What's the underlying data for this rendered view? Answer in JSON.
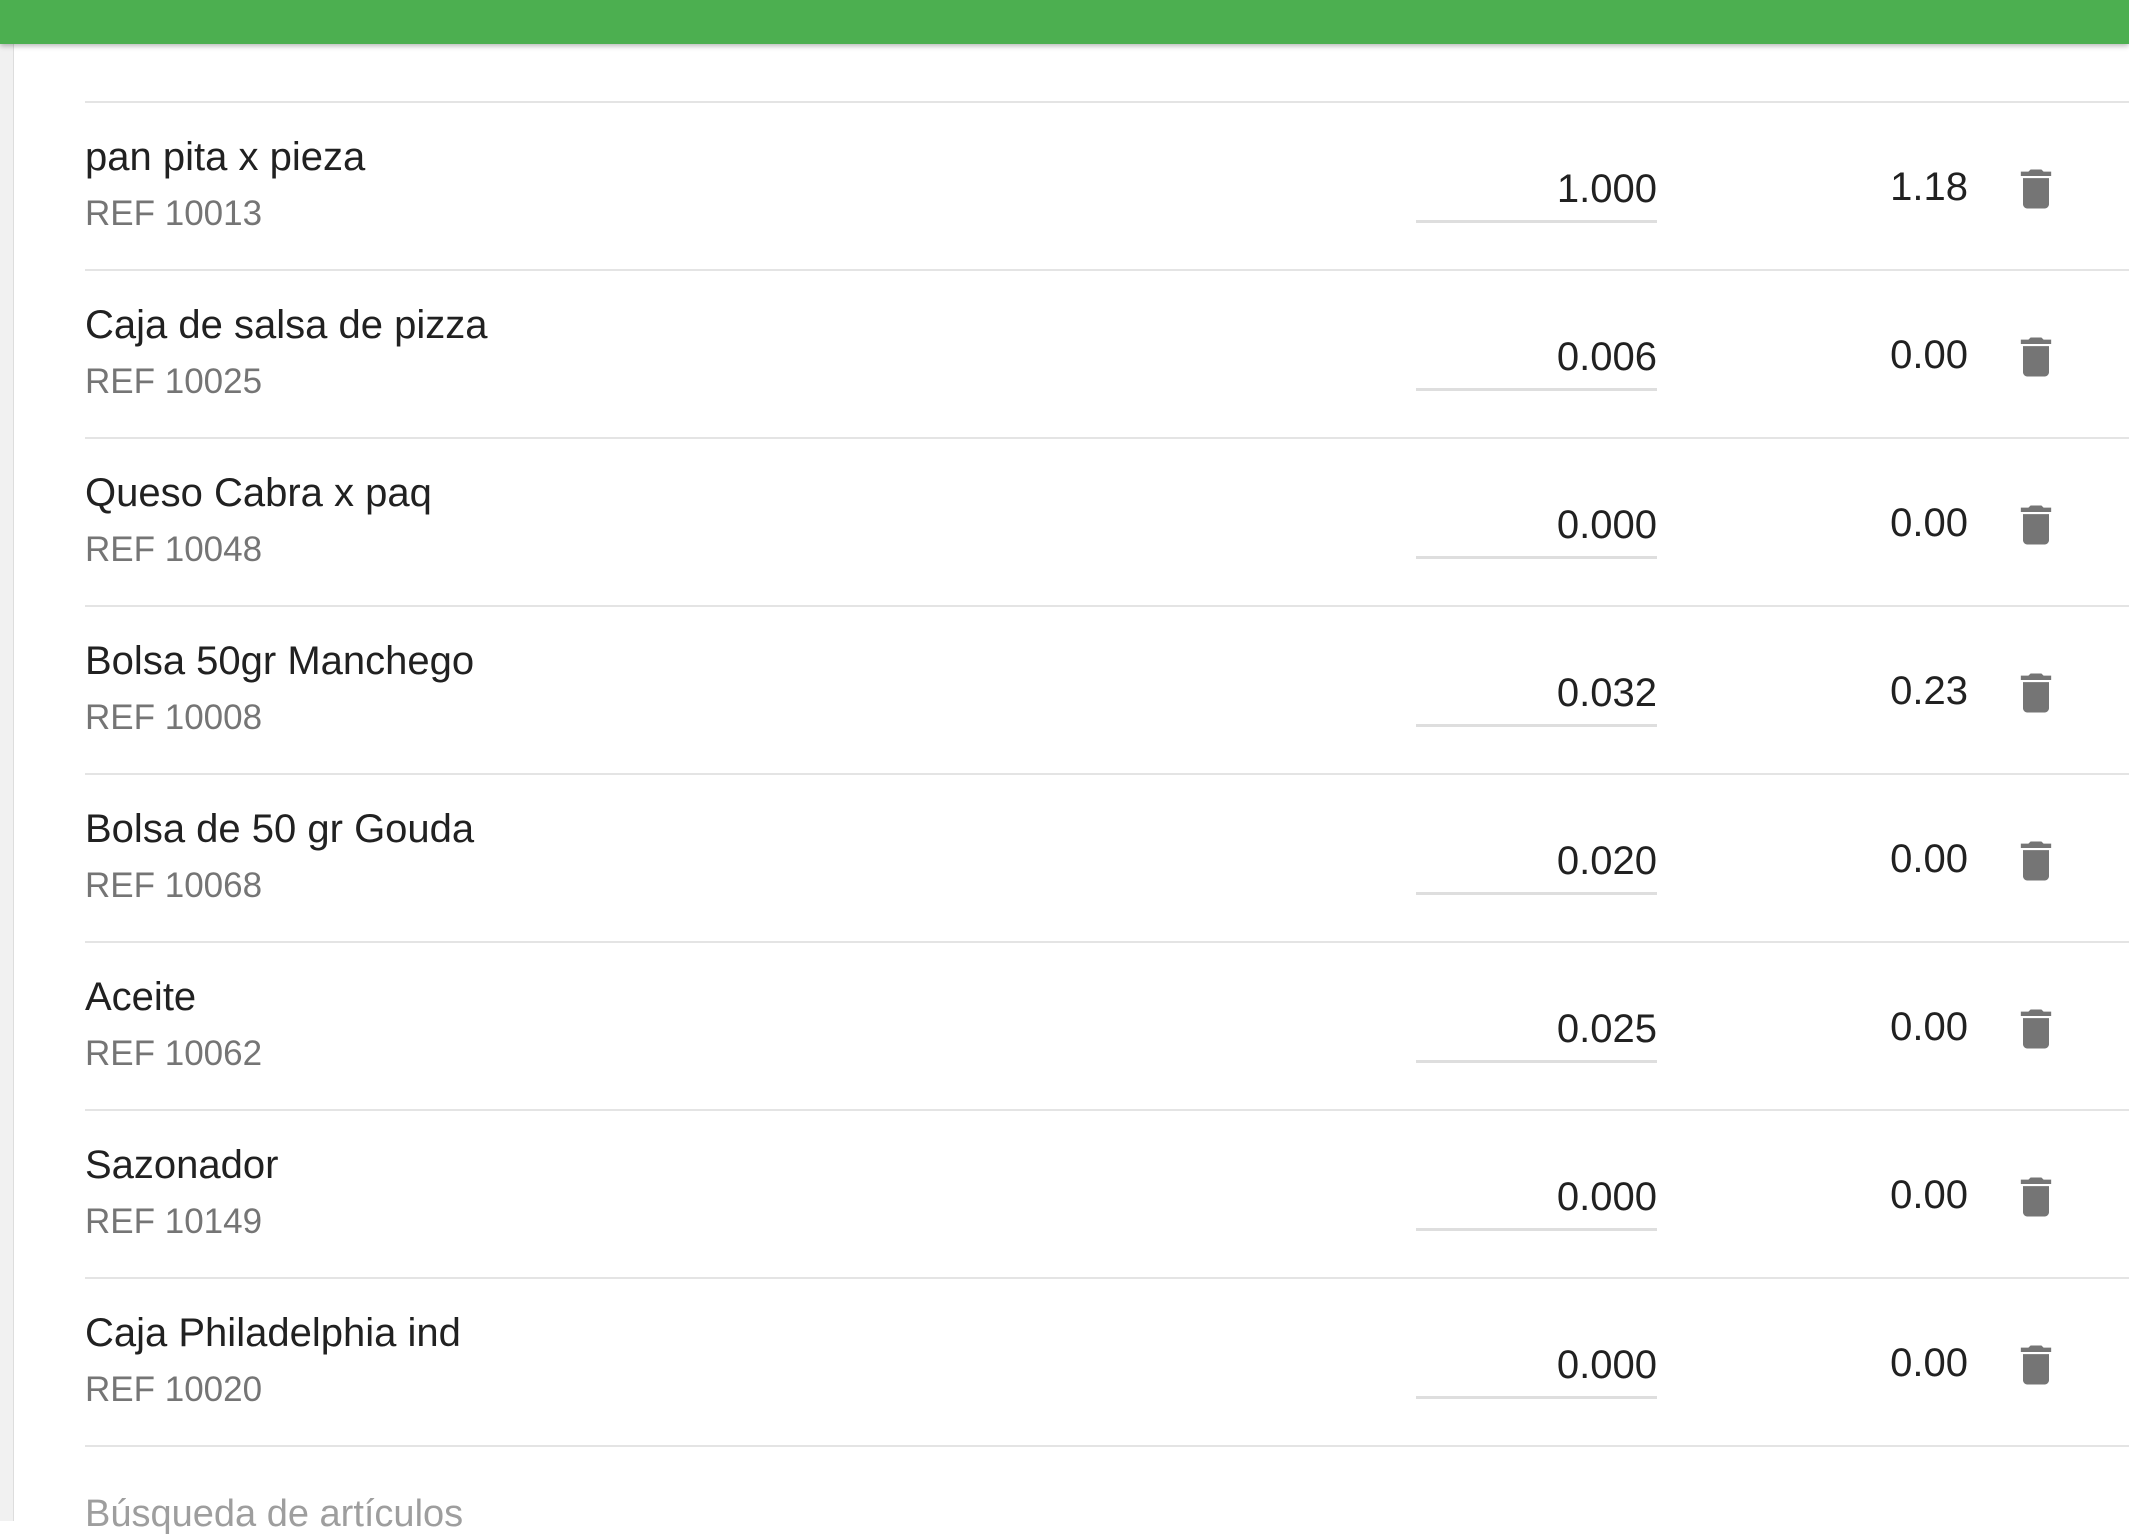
{
  "theme": {
    "accent": "#4caf50",
    "icon_color": "#757575"
  },
  "items": [
    {
      "name": "pan pita x pieza",
      "ref": "REF 10013",
      "qty": "1.000",
      "amount": "1.18"
    },
    {
      "name": "Caja de salsa de pizza",
      "ref": "REF 10025",
      "qty": "0.006",
      "amount": "0.00"
    },
    {
      "name": "Queso Cabra x paq",
      "ref": "REF 10048",
      "qty": "0.000",
      "amount": "0.00"
    },
    {
      "name": "Bolsa 50gr Manchego",
      "ref": "REF 10008",
      "qty": "0.032",
      "amount": "0.23"
    },
    {
      "name": "Bolsa de 50 gr Gouda",
      "ref": "REF 10068",
      "qty": "0.020",
      "amount": "0.00"
    },
    {
      "name": "Aceite",
      "ref": "REF 10062",
      "qty": "0.025",
      "amount": "0.00"
    },
    {
      "name": "Sazonador",
      "ref": "REF 10149",
      "qty": "0.000",
      "amount": "0.00"
    },
    {
      "name": "Caja Philadelphia ind",
      "ref": "REF 10020",
      "qty": "0.000",
      "amount": "0.00"
    }
  ],
  "row_icon": "trash-icon",
  "search": {
    "placeholder": "Búsqueda de artículos"
  }
}
